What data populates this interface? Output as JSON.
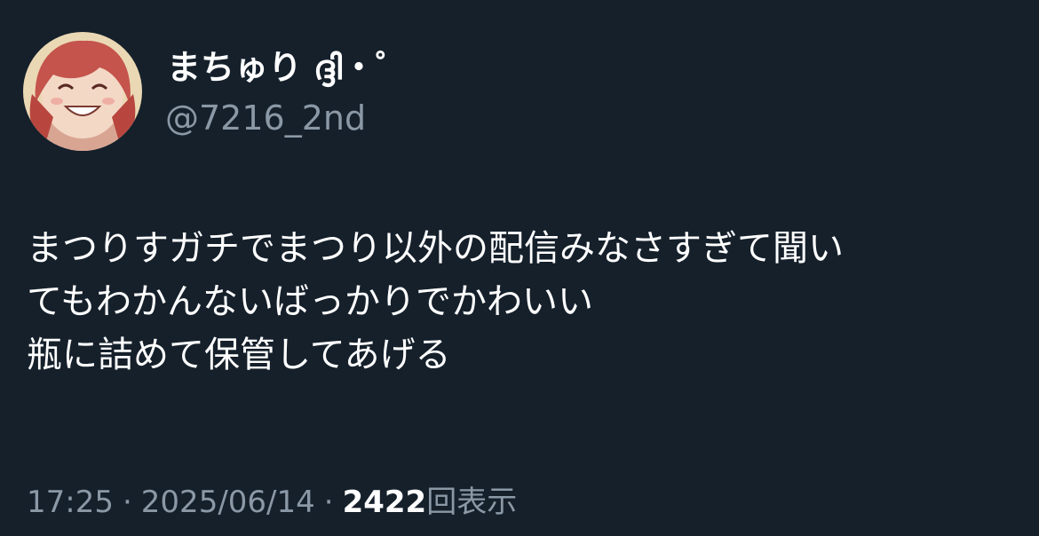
{
  "author": {
    "display_name": "まちゅり ദ്ദി・゜",
    "handle": "@7216_2nd",
    "avatar": "anime-girl-avatar"
  },
  "tweet": {
    "lines": [
      "まつりすガチでまつり以外の配信みなさすぎて聞い",
      "てもわかんないばっかりでかわいい",
      "瓶に詰めて保管してあげる"
    ]
  },
  "meta": {
    "time": "17:25",
    "separator": "·",
    "date": "2025/06/14",
    "views_count": "2422",
    "views_label": "回表示"
  },
  "colors": {
    "background": "#15202b",
    "primary_text": "#ffffff",
    "secondary_text": "#8b98a5"
  }
}
